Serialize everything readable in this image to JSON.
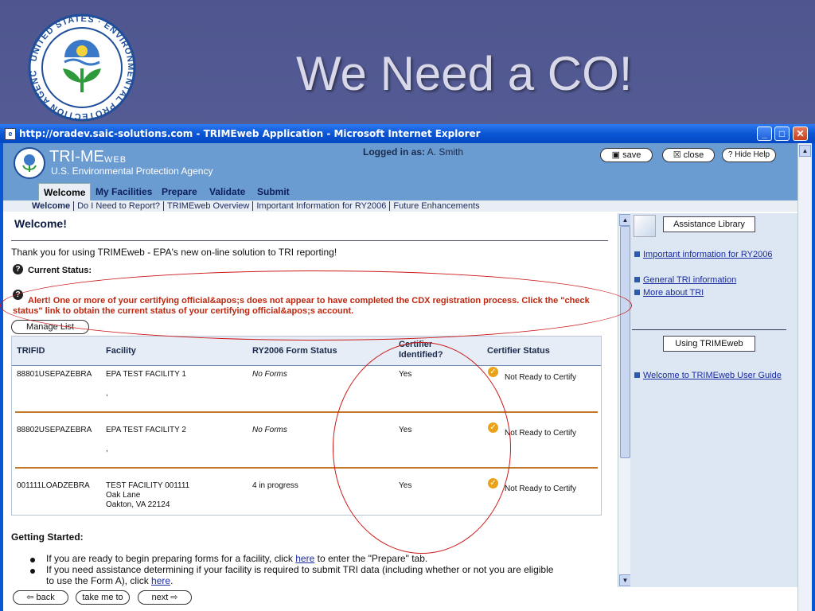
{
  "slide": {
    "title": "We Need a CO!"
  },
  "seal": {
    "text": "UNITED STATES ENVIRONMENTAL PROTECTION AGENCY",
    "icon": "epa-seal-icon"
  },
  "window": {
    "title": "http://oradev.saic-solutions.com - TRIMEweb Application - Microsoft Internet Explorer",
    "buttons": [
      "minimize",
      "maximize",
      "close"
    ]
  },
  "app": {
    "logo": "TRI-ME",
    "logo_sub": "WEB",
    "agency": "U.S. Environmental Protection Agency",
    "logged_in_label": "Logged in as:",
    "logged_in_user": "A. Smith",
    "save": "save",
    "close": "close",
    "hide_help": "? Hide Help"
  },
  "tabs": [
    "Welcome",
    "My Facilities",
    "Prepare",
    "Validate",
    "Submit"
  ],
  "subnav": [
    "Welcome",
    "Do I Need to Report?",
    "TRIMEweb Overview",
    "Important Information for RY2006",
    "Future Enhancements"
  ],
  "main": {
    "heading": "Welcome!",
    "intro": "Thank you for using TRIMEweb - EPA's new on-line solution to TRI reporting!",
    "status_label": "Current Status:",
    "alert": "Alert! One or more of your certifying official&apos;s does not appear to have completed the CDX registration process. Click the \"check status\" link to obtain the current status of your certifying official&apos;s account.",
    "manage_list": "Manage List",
    "table": {
      "headers": [
        "TRIFID",
        "Facility",
        "RY2006 Form Status",
        "Certifier Identified?",
        "Certifier Status"
      ],
      "rows": [
        {
          "trifid": "88801USEPAZEBRA",
          "facility": "EPA TEST FACILITY 1",
          "addr1": ",",
          "addr2": "",
          "form_status": "No Forms",
          "certifier": "Yes",
          "status": "Not Ready to Certify"
        },
        {
          "trifid": "88802USEPAZEBRA",
          "facility": "EPA TEST FACILITY 2",
          "addr1": ",",
          "addr2": "",
          "form_status": "No Forms",
          "certifier": "Yes",
          "status": "Not Ready to Certify"
        },
        {
          "trifid": "001111LOADZEBRA",
          "facility": "TEST FACILITY 001111",
          "addr1": "Oak Lane",
          "addr2": "Oakton, VA 22124",
          "form_status": "4 in progress",
          "certifier": "Yes",
          "status": "Not Ready to Certify"
        }
      ]
    },
    "getting_started": "Getting Started:",
    "bullet1_a": "If you are ready to begin preparing forms for a facility, click ",
    "bullet1_link": "here",
    "bullet1_b": " to enter the \"Prepare\" tab.",
    "bullet2_a": "If you need assistance determining if your facility is required to submit TRI data (including whether or not you are eligible",
    "bullet2_b": "to use the Form A), click ",
    "bullet2_link": "here",
    "bullet2_c": "."
  },
  "help": {
    "assistance_library": "Assistance Library",
    "links": [
      "Important information for RY2006",
      "General TRI information",
      "More about TRI"
    ],
    "using": "Using TRIMEweb",
    "guide": "Welcome to TRIMEweb User Guide"
  },
  "nav": {
    "back": "back",
    "take_me_to": "take me to",
    "next": "next"
  }
}
